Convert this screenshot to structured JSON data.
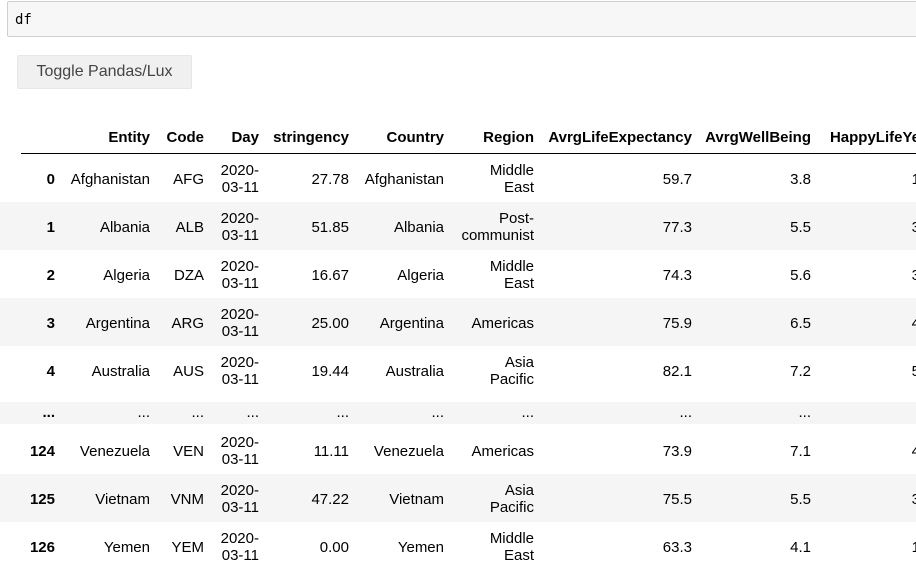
{
  "input": {
    "code": "df"
  },
  "toggle_button": {
    "label": "Toggle Pandas/Lux"
  },
  "table": {
    "columns": [
      "Entity",
      "Code",
      "Day",
      "stringency",
      "Country",
      "Region",
      "AvrgLifeExpectancy",
      "AvrgWellBeing",
      "HappyLifeYe"
    ],
    "rows": [
      {
        "index": "0",
        "cells": [
          "Afghanistan",
          "AFG",
          [
            "2020-",
            "03-11"
          ],
          "27.78",
          "Afghanistan",
          [
            "Middle",
            "East"
          ],
          "59.7",
          "3.8",
          "1"
        ]
      },
      {
        "index": "1",
        "cells": [
          "Albania",
          "ALB",
          [
            "2020-",
            "03-11"
          ],
          "51.85",
          "Albania",
          [
            "Post-",
            "communist"
          ],
          "77.3",
          "5.5",
          "3"
        ]
      },
      {
        "index": "2",
        "cells": [
          "Algeria",
          "DZA",
          [
            "2020-",
            "03-11"
          ],
          "16.67",
          "Algeria",
          [
            "Middle",
            "East"
          ],
          "74.3",
          "5.6",
          "3"
        ]
      },
      {
        "index": "3",
        "cells": [
          "Argentina",
          "ARG",
          [
            "2020-",
            "03-11"
          ],
          "25.00",
          "Argentina",
          [
            "Americas"
          ],
          "75.9",
          "6.5",
          "4"
        ]
      },
      {
        "index": "4",
        "cells": [
          "Australia",
          "AUS",
          [
            "2020-",
            "03-11"
          ],
          "19.44",
          "Australia",
          [
            "Asia",
            "Pacific"
          ],
          "82.1",
          "7.2",
          "5"
        ]
      },
      {
        "index": "...",
        "cells": [
          "...",
          "...",
          [
            "..."
          ],
          "...",
          "...",
          [
            "..."
          ],
          "...",
          "...",
          ""
        ]
      },
      {
        "index": "124",
        "cells": [
          "Venezuela",
          "VEN",
          [
            "2020-",
            "03-11"
          ],
          "11.11",
          "Venezuela",
          [
            "Americas"
          ],
          "73.9",
          "7.1",
          "4"
        ]
      },
      {
        "index": "125",
        "cells": [
          "Vietnam",
          "VNM",
          [
            "2020-",
            "03-11"
          ],
          "47.22",
          "Vietnam",
          [
            "Asia",
            "Pacific"
          ],
          "75.5",
          "5.5",
          "3"
        ]
      },
      {
        "index": "126",
        "cells": [
          "Yemen",
          "YEM",
          [
            "2020-",
            "03-11"
          ],
          "0.00",
          "Yemen",
          [
            "Middle",
            "East"
          ],
          "63.3",
          "4.1",
          "1"
        ]
      }
    ]
  }
}
